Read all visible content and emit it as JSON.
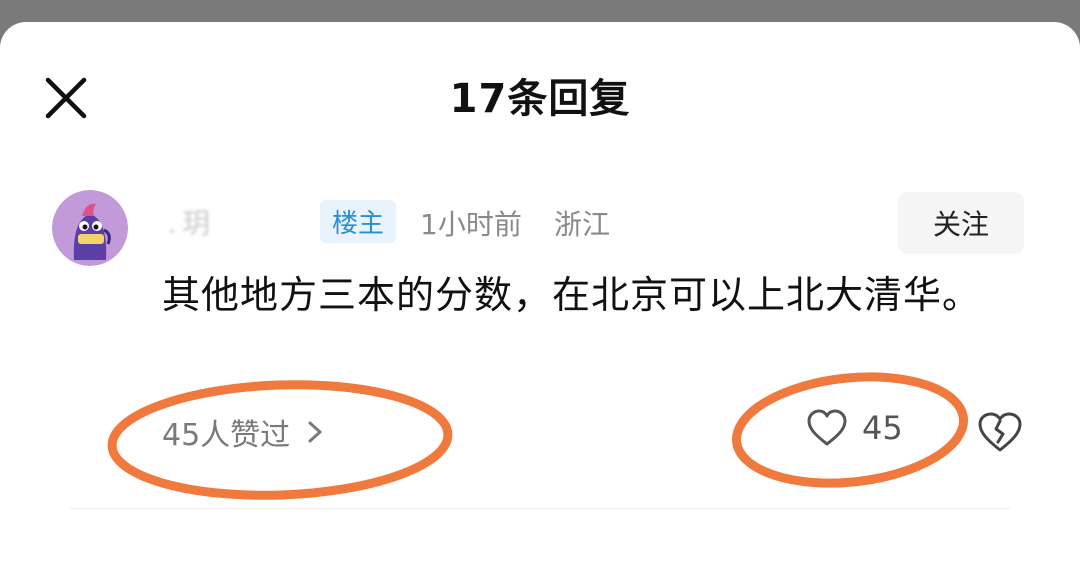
{
  "header": {
    "title": "17条回复",
    "close_icon": "close-icon"
  },
  "comment": {
    "username": " . 玥",
    "op_badge": "楼主",
    "time": "1小时前",
    "location": "浙江",
    "follow_label": "关注",
    "text": "其他地方三本的分数，在北京可以上北大清华。",
    "likers_label": "45人赞过",
    "like_count": "45"
  },
  "colors": {
    "badge_text": "#2b8fd3",
    "badge_bg": "#e9f3fb",
    "annotation": "#f07a3d",
    "avatar_bg": "#c39ad9"
  },
  "icons": {
    "avatar": "mascot-avatar",
    "likers_chevron": "chevron-right-icon",
    "like": "heart-icon",
    "dislike": "broken-heart-icon"
  }
}
